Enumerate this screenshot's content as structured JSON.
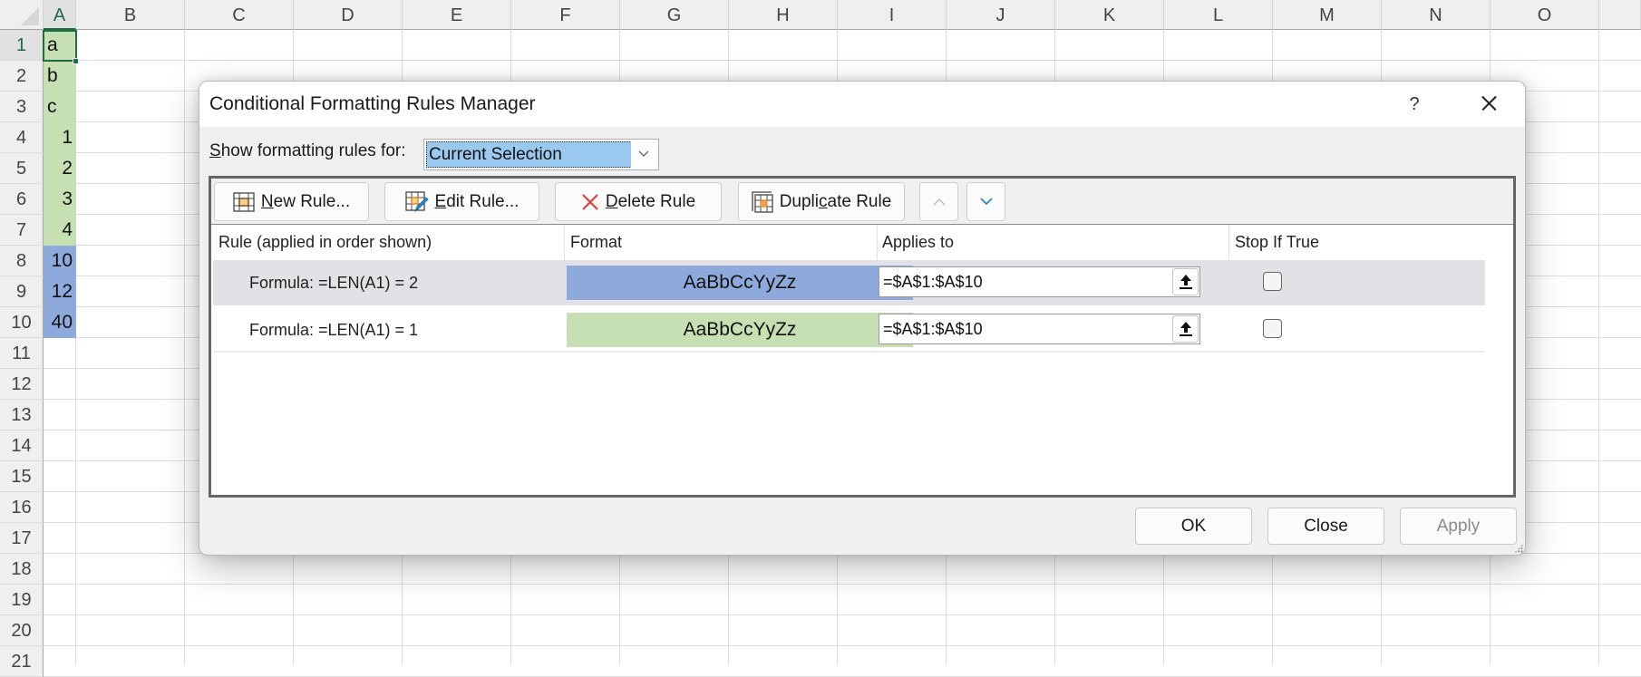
{
  "spreadsheet": {
    "columns": [
      "A",
      "B",
      "C",
      "D",
      "E",
      "F",
      "G",
      "H",
      "I",
      "J",
      "K",
      "L",
      "M",
      "N",
      "O"
    ],
    "rows": [
      "1",
      "2",
      "3",
      "4",
      "5",
      "6",
      "7",
      "8",
      "9",
      "10",
      "11",
      "12",
      "13",
      "14",
      "15",
      "16",
      "17",
      "18",
      "19",
      "20",
      "21"
    ],
    "selected_column": "A",
    "active_cell": "A1",
    "column_a_values": [
      {
        "value": "a",
        "type": "text",
        "fill": "#c6e0b4"
      },
      {
        "value": "b",
        "type": "text",
        "fill": "#c6e0b4"
      },
      {
        "value": "c",
        "type": "text",
        "fill": "#c6e0b4"
      },
      {
        "value": "1",
        "type": "number",
        "fill": "#c6e0b4"
      },
      {
        "value": "2",
        "type": "number",
        "fill": "#c6e0b4"
      },
      {
        "value": "3",
        "type": "number",
        "fill": "#c6e0b4"
      },
      {
        "value": "4",
        "type": "number",
        "fill": "#c6e0b4"
      },
      {
        "value": "10",
        "type": "number",
        "fill": "#8ea9db"
      },
      {
        "value": "12",
        "type": "number",
        "fill": "#8ea9db"
      },
      {
        "value": "40",
        "type": "number",
        "fill": "#8ea9db"
      }
    ]
  },
  "dialog": {
    "title": "Conditional Formatting Rules Manager",
    "help_label": "?",
    "show_rules_label_prefix": "S",
    "show_rules_label_rest": "how formatting rules for:",
    "scope_value": "Current Selection",
    "toolbar": {
      "new_rule": {
        "ul": "N",
        "rest": "ew Rule..."
      },
      "edit_rule": {
        "ul": "E",
        "rest": "dit Rule..."
      },
      "delete_rule": {
        "ul": "D",
        "rest": "elete Rule"
      },
      "duplicate_rule": {
        "pre": "Dupli",
        "ul": "c",
        "rest": "ate Rule"
      }
    },
    "columns": {
      "rule": "Rule (applied in order shown)",
      "format": "Format",
      "applies_to": "Applies to",
      "stop_if_true": "Stop If True"
    },
    "rules": [
      {
        "rule": "Formula: =LEN(A1) = 2",
        "preview_text": "AaBbCcYyZz",
        "preview_color": "#8ea9db",
        "applies_to": "=$A$1:$A$10",
        "stop_if_true": false,
        "selected": true
      },
      {
        "rule": "Formula: =LEN(A1) = 1",
        "preview_text": "AaBbCcYyZz",
        "preview_color": "#c6e0b4",
        "applies_to": "=$A$1:$A$10",
        "stop_if_true": false,
        "selected": false
      }
    ],
    "footer": {
      "ok": "OK",
      "close": "Close",
      "apply": "Apply"
    },
    "accent_color": "#99c9ef"
  }
}
